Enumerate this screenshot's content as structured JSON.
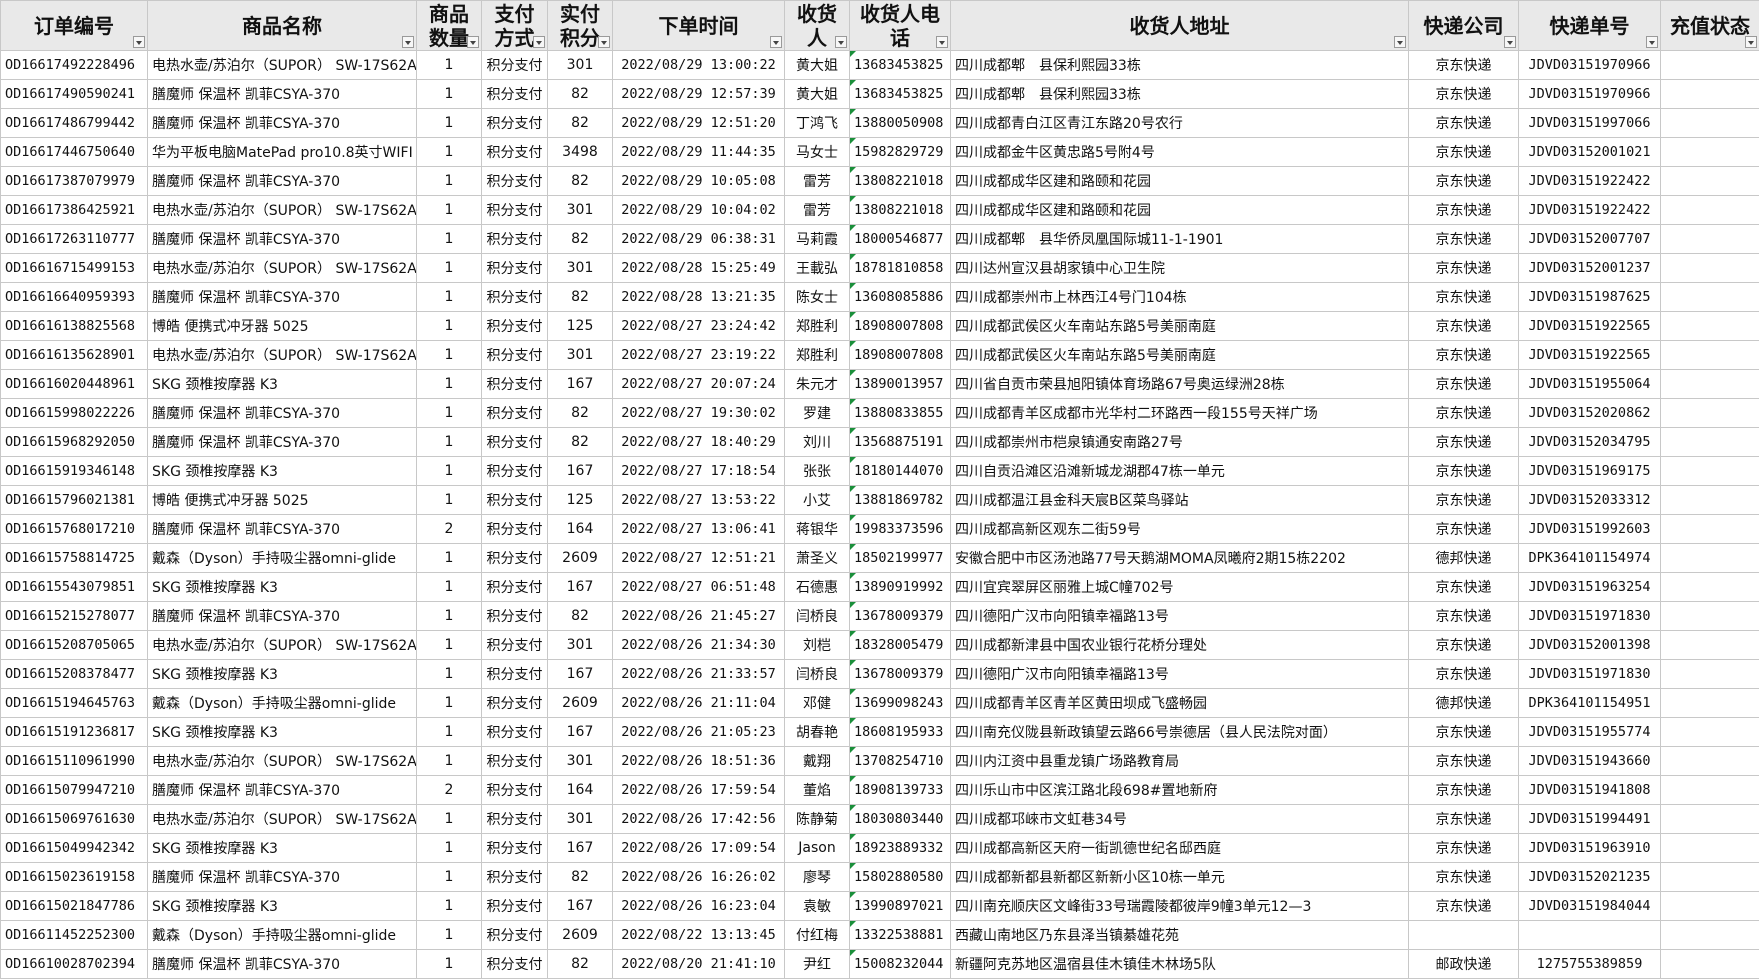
{
  "headers": [
    "订单编号",
    "商品名称",
    "商品数量",
    "支付方式",
    "实付积分",
    "下单时间",
    "收货人",
    "收货人电话",
    "收货人地址",
    "快递公司",
    "快递单号",
    "充值状态"
  ],
  "rows": [
    [
      "OD16617492228496",
      "电热水壶/苏泊尔（SUPOR） SW-17S62A",
      "1",
      "积分支付",
      "301",
      "2022/08/29 13:00:22",
      "黄大姐",
      "13683453825",
      "四川成都郫　县保利熙园33栋",
      "京东快递",
      "JDVD03151970966",
      ""
    ],
    [
      "OD16617490590241",
      "膳魔师 保温杯 凯菲CSYA-370",
      "1",
      "积分支付",
      "82",
      "2022/08/29 12:57:39",
      "黄大姐",
      "13683453825",
      "四川成都郫　县保利熙园33栋",
      "京东快递",
      "JDVD03151970966",
      ""
    ],
    [
      "OD16617486799442",
      "膳魔师 保温杯 凯菲CSYA-370",
      "1",
      "积分支付",
      "82",
      "2022/08/29 12:51:20",
      "丁鸿飞",
      "13880050908",
      "四川成都青白江区青江东路20号农行",
      "京东快递",
      "JDVD03151997066",
      ""
    ],
    [
      "OD16617446750640",
      "华为平板电脑MatePad pro10.8英寸WIFI",
      "1",
      "积分支付",
      "3498",
      "2022/08/29 11:44:35",
      "马女士",
      "15982829729",
      "四川成都金牛区黄忠路5号附4号",
      "京东快递",
      "JDVD03152001021",
      ""
    ],
    [
      "OD16617387079979",
      "膳魔师 保温杯 凯菲CSYA-370",
      "1",
      "积分支付",
      "82",
      "2022/08/29 10:05:08",
      "雷芳",
      "13808221018",
      "四川成都成华区建和路颐和花园",
      "京东快递",
      "JDVD03151922422",
      ""
    ],
    [
      "OD16617386425921",
      "电热水壶/苏泊尔（SUPOR） SW-17S62A",
      "1",
      "积分支付",
      "301",
      "2022/08/29 10:04:02",
      "雷芳",
      "13808221018",
      "四川成都成华区建和路颐和花园",
      "京东快递",
      "JDVD03151922422",
      ""
    ],
    [
      "OD16617263110777",
      "膳魔师 保温杯 凯菲CSYA-370",
      "1",
      "积分支付",
      "82",
      "2022/08/29 06:38:31",
      "马莉霞",
      "18000546877",
      "四川成都郫　县华侨凤凰国际城11-1-1901",
      "京东快递",
      "JDVD03152007707",
      ""
    ],
    [
      "OD16616715499153",
      "电热水壶/苏泊尔（SUPOR） SW-17S62A",
      "1",
      "积分支付",
      "301",
      "2022/08/28 15:25:49",
      "王載弘",
      "18781810858",
      "四川达州宣汉县胡家镇中心卫生院",
      "京东快递",
      "JDVD03152001237",
      ""
    ],
    [
      "OD16616640959393",
      "膳魔师 保温杯 凯菲CSYA-370",
      "1",
      "积分支付",
      "82",
      "2022/08/28 13:21:35",
      "陈女士",
      "13608085886",
      "四川成都崇州市上林西江4号门104栋",
      "京东快递",
      "JDVD03151987625",
      ""
    ],
    [
      "OD16616138825568",
      "博皓 便携式冲牙器 5025",
      "1",
      "积分支付",
      "125",
      "2022/08/27 23:24:42",
      "郑胜利",
      "18908007808",
      "四川成都武侯区火车南站东路5号美丽南庭",
      "京东快递",
      "JDVD03151922565",
      ""
    ],
    [
      "OD16616135628901",
      "电热水壶/苏泊尔（SUPOR） SW-17S62A",
      "1",
      "积分支付",
      "301",
      "2022/08/27 23:19:22",
      "郑胜利",
      "18908007808",
      "四川成都武侯区火车南站东路5号美丽南庭",
      "京东快递",
      "JDVD03151922565",
      ""
    ],
    [
      "OD16616020448961",
      "SKG 颈椎按摩器 K3",
      "1",
      "积分支付",
      "167",
      "2022/08/27 20:07:24",
      "朱元才",
      "13890013957",
      "四川省自贡市荣县旭阳镇体育场路67号奥运绿洲28栋",
      "京东快递",
      "JDVD03151955064",
      ""
    ],
    [
      "OD16615998022226",
      "膳魔师 保温杯 凯菲CSYA-370",
      "1",
      "积分支付",
      "82",
      "2022/08/27 19:30:02",
      "罗建",
      "13880833855",
      "四川成都青羊区成都市光华村二环路西一段155号天祥广场",
      "京东快递",
      "JDVD03152020862",
      ""
    ],
    [
      "OD16615968292050",
      "膳魔师 保温杯 凯菲CSYA-370",
      "1",
      "积分支付",
      "82",
      "2022/08/27 18:40:29",
      "刘川",
      "13568875191",
      "四川成都崇州市桤泉镇通安南路27号",
      "京东快递",
      "JDVD03152034795",
      ""
    ],
    [
      "OD16615919346148",
      "SKG 颈椎按摩器 K3",
      "1",
      "积分支付",
      "167",
      "2022/08/27 17:18:54",
      "张张",
      "18180144070",
      "四川自贡沿滩区沿滩新城龙湖郡47栋一单元",
      "京东快递",
      "JDVD03151969175",
      ""
    ],
    [
      "OD16615796021381",
      "博皓 便携式冲牙器 5025",
      "1",
      "积分支付",
      "125",
      "2022/08/27 13:53:22",
      "小艾",
      "13881869782",
      "四川成都温江县金科天宸B区菜鸟驿站",
      "京东快递",
      "JDVD03152033312",
      ""
    ],
    [
      "OD16615768017210",
      "膳魔师 保温杯 凯菲CSYA-370",
      "2",
      "积分支付",
      "164",
      "2022/08/27 13:06:41",
      "蒋银华",
      "19983373596",
      "四川成都高新区观东二街59号",
      "京东快递",
      "JDVD03151992603",
      ""
    ],
    [
      "OD16615758814725",
      "戴森（Dyson）手持吸尘器omni-glide",
      "1",
      "积分支付",
      "2609",
      "2022/08/27 12:51:21",
      "萧圣义",
      "18502199977",
      "安徽合肥中市区汤池路77号天鹅湖MOMA凤曦府2期15栋2202",
      "德邦快递",
      "DPK364101154974",
      ""
    ],
    [
      "OD16615543079851",
      "SKG 颈椎按摩器 K3",
      "1",
      "积分支付",
      "167",
      "2022/08/27 06:51:48",
      "石德惠",
      "13890919992",
      "四川宜宾翠屏区丽雅上城C幢702号",
      "京东快递",
      "JDVD03151963254",
      ""
    ],
    [
      "OD16615215278077",
      "膳魔师 保温杯 凯菲CSYA-370",
      "1",
      "积分支付",
      "82",
      "2022/08/26 21:45:27",
      "闫桥良",
      "13678009379",
      "四川德阳广汉市向阳镇幸福路13号",
      "京东快递",
      "JDVD03151971830",
      ""
    ],
    [
      "OD16615208705065",
      "电热水壶/苏泊尔（SUPOR） SW-17S62A",
      "1",
      "积分支付",
      "301",
      "2022/08/26 21:34:30",
      "刘桤",
      "18328005479",
      "四川成都新津县中国农业银行花桥分理处",
      "京东快递",
      "JDVD03152001398",
      ""
    ],
    [
      "OD16615208378477",
      "SKG 颈椎按摩器 K3",
      "1",
      "积分支付",
      "167",
      "2022/08/26 21:33:57",
      "闫桥良",
      "13678009379",
      "四川德阳广汉市向阳镇幸福路13号",
      "京东快递",
      "JDVD03151971830",
      ""
    ],
    [
      "OD16615194645763",
      "戴森（Dyson）手持吸尘器omni-glide",
      "1",
      "积分支付",
      "2609",
      "2022/08/26 21:11:04",
      "邓健",
      "13699098243",
      "四川成都青羊区青羊区黄田坝成飞盛畅园",
      "德邦快递",
      "DPK364101154951",
      ""
    ],
    [
      "OD16615191236817",
      "SKG 颈椎按摩器 K3",
      "1",
      "积分支付",
      "167",
      "2022/08/26 21:05:23",
      "胡春艳",
      "18608195933",
      "四川南充仪陇县新政镇望云路66号崇德居（县人民法院对面）",
      "京东快递",
      "JDVD03151955774",
      ""
    ],
    [
      "OD16615110961990",
      "电热水壶/苏泊尔（SUPOR） SW-17S62A",
      "1",
      "积分支付",
      "301",
      "2022/08/26 18:51:36",
      "戴翔",
      "13708254710",
      "四川内江资中县重龙镇广场路教育局",
      "京东快递",
      "JDVD03151943660",
      ""
    ],
    [
      "OD16615079947210",
      "膳魔师 保温杯 凯菲CSYA-370",
      "2",
      "积分支付",
      "164",
      "2022/08/26 17:59:54",
      "董焰",
      "18908139733",
      "四川乐山市中区滨江路北段698#置地新府",
      "京东快递",
      "JDVD03151941808",
      ""
    ],
    [
      "OD16615069761630",
      "电热水壶/苏泊尔（SUPOR） SW-17S62A",
      "1",
      "积分支付",
      "301",
      "2022/08/26 17:42:56",
      "陈静菊",
      "18030803440",
      "四川成都邛崍市文虹巷34号",
      "京东快递",
      "JDVD03151994491",
      ""
    ],
    [
      "OD16615049942342",
      "SKG 颈椎按摩器 K3",
      "1",
      "积分支付",
      "167",
      "2022/08/26 17:09:54",
      "Jason",
      "18923889332",
      "四川成都高新区天府一街凯德世纪名邸西庭",
      "京东快递",
      "JDVD03151963910",
      ""
    ],
    [
      "OD16615023619158",
      "膳魔师 保温杯 凯菲CSYA-370",
      "1",
      "积分支付",
      "82",
      "2022/08/26 16:26:02",
      "廖琴",
      "15802880580",
      "四川成都新都县新都区新新小区10栋一单元",
      "京东快递",
      "JDVD03152021235",
      ""
    ],
    [
      "OD16615021847786",
      "SKG 颈椎按摩器 K3",
      "1",
      "积分支付",
      "167",
      "2022/08/26 16:23:04",
      "袁敏",
      "13990897021",
      "四川南充顺庆区文峰街33号瑞霞陵都彼岸9幢3单元12—3",
      "京东快递",
      "JDVD03151984044",
      ""
    ],
    [
      "OD16611452252300",
      "戴森（Dyson）手持吸尘器omni-glide",
      "1",
      "积分支付",
      "2609",
      "2022/08/22 13:13:45",
      "付红梅",
      "13322538881",
      "西藏山南地区乃东县泽当镇綦雄花苑",
      "",
      "",
      " "
    ],
    [
      "OD16610028702394",
      "膳魔师 保温杯 凯菲CSYA-370",
      "1",
      "积分支付",
      "82",
      "2022/08/20 21:41:10",
      "尹红",
      "15008232044",
      "新疆阿克苏地区温宿县佳木镇佳木林场5队",
      "邮政快递",
      "1275755389859",
      ""
    ]
  ]
}
